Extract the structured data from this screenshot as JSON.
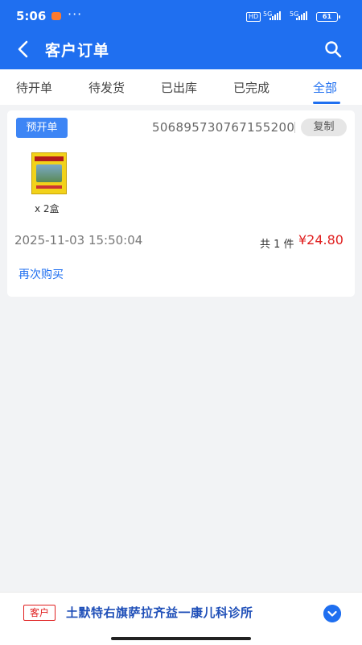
{
  "status_bar": {
    "time": "5:06",
    "dots": "···",
    "hd": "HD",
    "signal1": "5G",
    "signal2": "5G",
    "battery": "61"
  },
  "header": {
    "title": "客户订单",
    "icons": {
      "back": "chevron-left-icon",
      "search": "search-icon"
    }
  },
  "tabs": [
    {
      "label": "待开单",
      "active": false
    },
    {
      "label": "待发货",
      "active": false
    },
    {
      "label": "已出库",
      "active": false
    },
    {
      "label": "已完成",
      "active": false
    },
    {
      "label": "全部",
      "active": true
    }
  ],
  "order": {
    "status_badge": "预开单",
    "order_no": "506895730767155200",
    "copy_label": "复制",
    "quantity": "x 2盒",
    "datetime": "2025-11-03 15:50:04",
    "total_label": "共 1 件",
    "price": "¥24.80",
    "reorder_label": "再次购买"
  },
  "bottom": {
    "tag": "客户",
    "customer_name": "土默特右旗萨拉齐益一康儿科诊所",
    "expand_icon": "chevron-down-icon"
  },
  "colors": {
    "primary": "#1f6ff0",
    "price": "#e02020",
    "background": "#f2f3f5"
  }
}
